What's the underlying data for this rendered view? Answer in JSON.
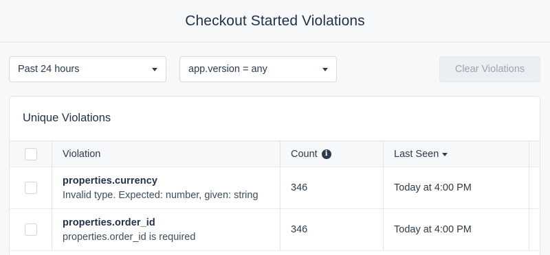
{
  "header": {
    "title": "Checkout Started Violations"
  },
  "filters": {
    "time_range": "Past 24 hours",
    "version_filter": "app.version = any",
    "clear_label": "Clear Violations"
  },
  "card": {
    "title": "Unique Violations",
    "columns": {
      "violation": "Violation",
      "count": "Count",
      "last_seen": "Last Seen"
    },
    "rows": [
      {
        "name": "properties.currency",
        "description": "Invalid type. Expected: number, given: string",
        "count": "346",
        "last_seen": "Today at 4:00 PM"
      },
      {
        "name": "properties.order_id",
        "description": "properties.order_id is required",
        "count": "346",
        "last_seen": "Today at 4:00 PM"
      }
    ]
  },
  "icons": {
    "info": "info-icon",
    "sort": "caret-down-icon",
    "dropdown": "caret-down-icon"
  }
}
